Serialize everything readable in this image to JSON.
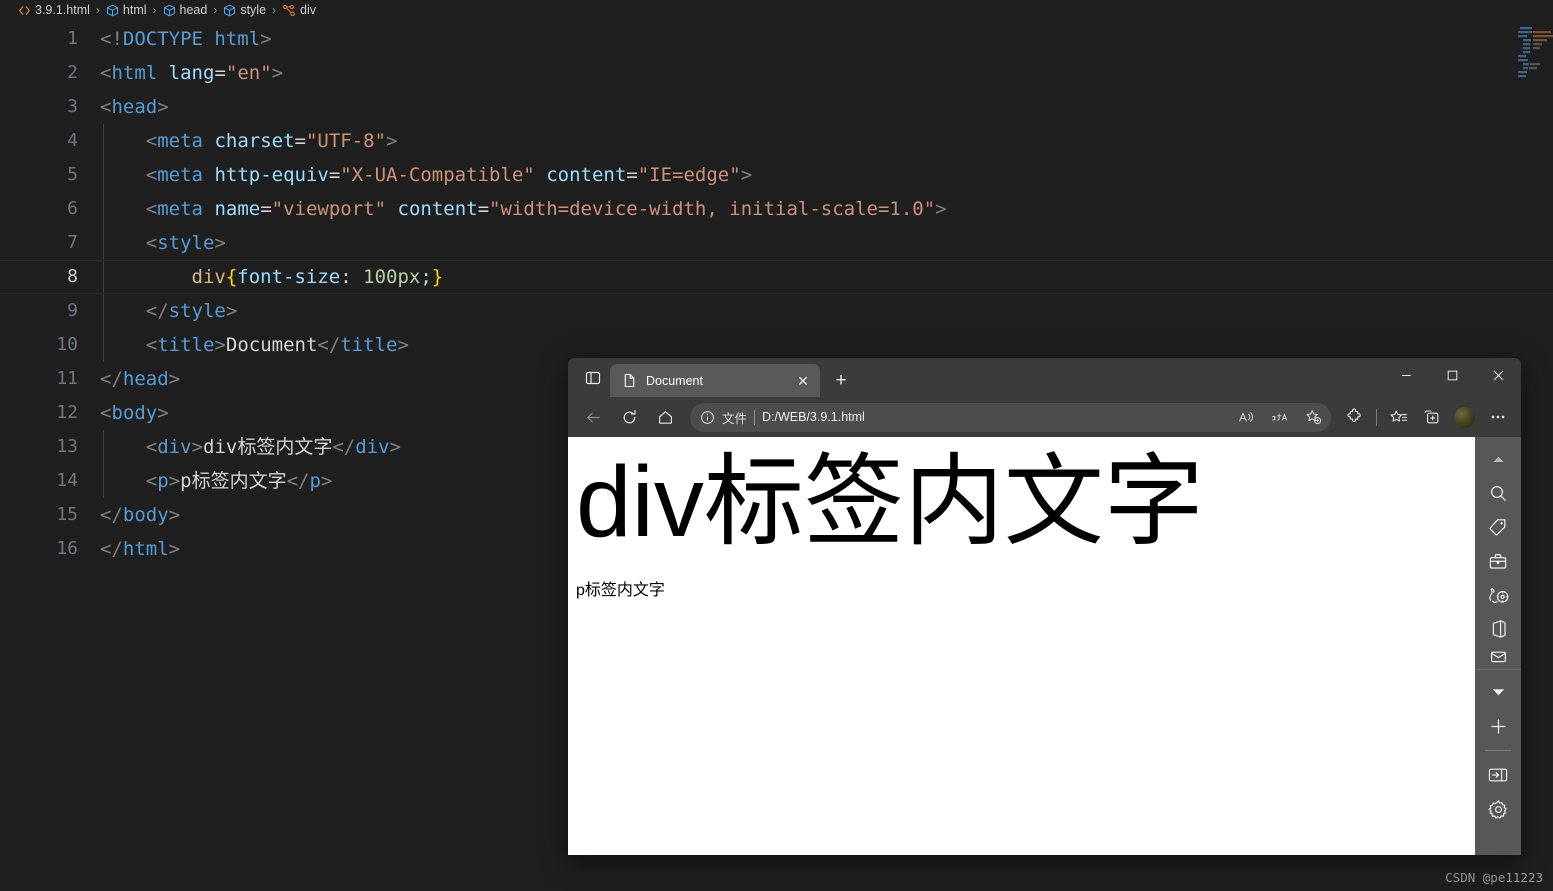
{
  "editor": {
    "breadcrumb": [
      {
        "icon": "html-file-icon",
        "label": "3.9.1.html"
      },
      {
        "icon": "element-cube-icon",
        "label": "html"
      },
      {
        "icon": "element-cube-icon",
        "label": "head"
      },
      {
        "icon": "element-cube-icon",
        "label": "style"
      },
      {
        "icon": "css-selector-icon",
        "label": "div"
      }
    ],
    "separator": "›",
    "active_line": 8,
    "lines": [
      {
        "n": "1",
        "tokens": [
          {
            "c": "punc",
            "t": "<!"
          },
          {
            "c": "tag",
            "t": "DOCTYPE"
          },
          {
            "c": "txt",
            "t": " "
          },
          {
            "c": "tag",
            "t": "html"
          },
          {
            "c": "punc",
            "t": ">"
          }
        ]
      },
      {
        "n": "2",
        "tokens": [
          {
            "c": "punc",
            "t": "<"
          },
          {
            "c": "tag",
            "t": "html"
          },
          {
            "c": "txt",
            "t": " "
          },
          {
            "c": "attr",
            "t": "lang"
          },
          {
            "c": "eq",
            "t": "="
          },
          {
            "c": "str",
            "t": "\"en\""
          },
          {
            "c": "punc",
            "t": ">"
          }
        ]
      },
      {
        "n": "3",
        "tokens": [
          {
            "c": "punc",
            "t": "<"
          },
          {
            "c": "tag",
            "t": "head"
          },
          {
            "c": "punc",
            "t": ">"
          }
        ]
      },
      {
        "n": "4",
        "tokens": [
          {
            "c": "txt",
            "t": "    "
          },
          {
            "c": "punc",
            "t": "<"
          },
          {
            "c": "tag",
            "t": "meta"
          },
          {
            "c": "txt",
            "t": " "
          },
          {
            "c": "attr",
            "t": "charset"
          },
          {
            "c": "eq",
            "t": "="
          },
          {
            "c": "str",
            "t": "\"UTF-8\""
          },
          {
            "c": "punc",
            "t": ">"
          }
        ]
      },
      {
        "n": "5",
        "tokens": [
          {
            "c": "txt",
            "t": "    "
          },
          {
            "c": "punc",
            "t": "<"
          },
          {
            "c": "tag",
            "t": "meta"
          },
          {
            "c": "txt",
            "t": " "
          },
          {
            "c": "attr",
            "t": "http-equiv"
          },
          {
            "c": "eq",
            "t": "="
          },
          {
            "c": "str",
            "t": "\"X-UA-Compatible\""
          },
          {
            "c": "txt",
            "t": " "
          },
          {
            "c": "attr",
            "t": "content"
          },
          {
            "c": "eq",
            "t": "="
          },
          {
            "c": "str",
            "t": "\"IE=edge\""
          },
          {
            "c": "punc",
            "t": ">"
          }
        ]
      },
      {
        "n": "6",
        "tokens": [
          {
            "c": "txt",
            "t": "    "
          },
          {
            "c": "punc",
            "t": "<"
          },
          {
            "c": "tag",
            "t": "meta"
          },
          {
            "c": "txt",
            "t": " "
          },
          {
            "c": "attr",
            "t": "name"
          },
          {
            "c": "eq",
            "t": "="
          },
          {
            "c": "str",
            "t": "\"viewport\""
          },
          {
            "c": "txt",
            "t": " "
          },
          {
            "c": "attr",
            "t": "content"
          },
          {
            "c": "eq",
            "t": "="
          },
          {
            "c": "str",
            "t": "\"width=device-width, initial-scale=1.0\""
          },
          {
            "c": "punc",
            "t": ">"
          }
        ]
      },
      {
        "n": "7",
        "tokens": [
          {
            "c": "txt",
            "t": "    "
          },
          {
            "c": "punc",
            "t": "<"
          },
          {
            "c": "tag",
            "t": "style"
          },
          {
            "c": "punc",
            "t": ">"
          }
        ]
      },
      {
        "n": "8",
        "tokens": [
          {
            "c": "txt",
            "t": "        "
          },
          {
            "c": "sel",
            "t": "div"
          },
          {
            "c": "brace",
            "t": "{"
          },
          {
            "c": "prop",
            "t": "font-size"
          },
          {
            "c": "eq",
            "t": ": "
          },
          {
            "c": "num",
            "t": "100px"
          },
          {
            "c": "eq",
            "t": ";"
          },
          {
            "c": "brace",
            "t": "}"
          }
        ]
      },
      {
        "n": "9",
        "tokens": [
          {
            "c": "txt",
            "t": "    "
          },
          {
            "c": "punc",
            "t": "</"
          },
          {
            "c": "tag",
            "t": "style"
          },
          {
            "c": "punc",
            "t": ">"
          }
        ]
      },
      {
        "n": "10",
        "tokens": [
          {
            "c": "txt",
            "t": "    "
          },
          {
            "c": "punc",
            "t": "<"
          },
          {
            "c": "tag",
            "t": "title"
          },
          {
            "c": "punc",
            "t": ">"
          },
          {
            "c": "txt",
            "t": "Document"
          },
          {
            "c": "punc",
            "t": "</"
          },
          {
            "c": "tag",
            "t": "title"
          },
          {
            "c": "punc",
            "t": ">"
          }
        ]
      },
      {
        "n": "11",
        "tokens": [
          {
            "c": "punc",
            "t": "</"
          },
          {
            "c": "tag",
            "t": "head"
          },
          {
            "c": "punc",
            "t": ">"
          }
        ]
      },
      {
        "n": "12",
        "tokens": [
          {
            "c": "punc",
            "t": "<"
          },
          {
            "c": "tag",
            "t": "body"
          },
          {
            "c": "punc",
            "t": ">"
          }
        ]
      },
      {
        "n": "13",
        "tokens": [
          {
            "c": "txt",
            "t": "    "
          },
          {
            "c": "punc",
            "t": "<"
          },
          {
            "c": "tag",
            "t": "div"
          },
          {
            "c": "punc",
            "t": ">"
          },
          {
            "c": "txt",
            "t": "div标签内文字"
          },
          {
            "c": "punc",
            "t": "</"
          },
          {
            "c": "tag",
            "t": "div"
          },
          {
            "c": "punc",
            "t": ">"
          }
        ]
      },
      {
        "n": "14",
        "tokens": [
          {
            "c": "txt",
            "t": "    "
          },
          {
            "c": "punc",
            "t": "<"
          },
          {
            "c": "tag",
            "t": "p"
          },
          {
            "c": "punc",
            "t": ">"
          },
          {
            "c": "txt",
            "t": "p标签内文字"
          },
          {
            "c": "punc",
            "t": "</"
          },
          {
            "c": "tag",
            "t": "p"
          },
          {
            "c": "punc",
            "t": ">"
          }
        ]
      },
      {
        "n": "15",
        "tokens": [
          {
            "c": "punc",
            "t": "</"
          },
          {
            "c": "tag",
            "t": "body"
          },
          {
            "c": "punc",
            "t": ">"
          }
        ]
      },
      {
        "n": "16",
        "tokens": [
          {
            "c": "punc",
            "t": "</"
          },
          {
            "c": "tag",
            "t": "html"
          },
          {
            "c": "punc",
            "t": ">"
          }
        ]
      }
    ],
    "watermark": "CSDN @pe11223"
  },
  "browser": {
    "tab_actions_icon": "tab-actions-icon",
    "tabs": [
      {
        "icon": "page-icon",
        "title": "Document",
        "close_label": "✕"
      }
    ],
    "new_tab_label": "+",
    "window_controls": {
      "minimize": "–",
      "maximize": "□",
      "close": "✕"
    },
    "nav": {
      "back_icon": "back-arrow-icon",
      "refresh_icon": "refresh-icon",
      "home_icon": "home-icon"
    },
    "omnibox": {
      "info_icon": "info-circle-icon",
      "scheme_label": "文件",
      "url": "D:/WEB/3.9.1.html",
      "read_aloud_icon": "read-aloud-icon",
      "translate_icon": "translate-icon",
      "add_favorite_icon": "add-favorite-star-icon"
    },
    "toolbar": [
      {
        "icon": "extensions-puzzle-icon"
      },
      {
        "icon": "favorites-star-icon"
      },
      {
        "icon": "collections-icon"
      },
      {
        "icon": "profile-avatar-icon"
      },
      {
        "icon": "settings-more-icon",
        "label": "⋯"
      }
    ],
    "page": {
      "div_text": "div标签内文字",
      "p_text": "p标签内文字"
    },
    "sidebar": [
      {
        "icon": "chevron-up-icon"
      },
      {
        "icon": "search-icon"
      },
      {
        "icon": "shopping-tag-icon"
      },
      {
        "icon": "tools-briefcase-icon"
      },
      {
        "icon": "games-icon"
      },
      {
        "icon": "office-icon"
      },
      {
        "icon": "outlook-icon"
      },
      {
        "icon": "chevron-down-icon"
      },
      {
        "icon": "add-plus-icon"
      },
      {
        "icon": "sidebar-toggle-icon"
      },
      {
        "icon": "settings-gear-icon"
      }
    ]
  }
}
